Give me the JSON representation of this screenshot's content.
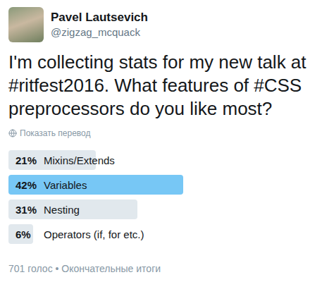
{
  "author": {
    "name": "Pavel Lautsevich",
    "handle": "@zigzag_mcquack"
  },
  "tweet": {
    "text": "I'm collecting stats for my new talk at #ritfest2016. What features of #CSS preprocessors do you like most?"
  },
  "translate": {
    "label": "Показать перевод"
  },
  "poll": {
    "options": [
      {
        "percent": "21%",
        "label": "Mixins/Extends",
        "level": 0.21,
        "leading": false
      },
      {
        "percent": "42%",
        "label": "Variables",
        "level": 0.42,
        "leading": true
      },
      {
        "percent": "31%",
        "label": "Nesting",
        "level": 0.31,
        "leading": false
      },
      {
        "percent": "6%",
        "label": "Operators (if, for etc.)",
        "level": 0.06,
        "leading": false
      }
    ]
  },
  "footer": {
    "text": "701 голос • Окончательные итоги"
  }
}
